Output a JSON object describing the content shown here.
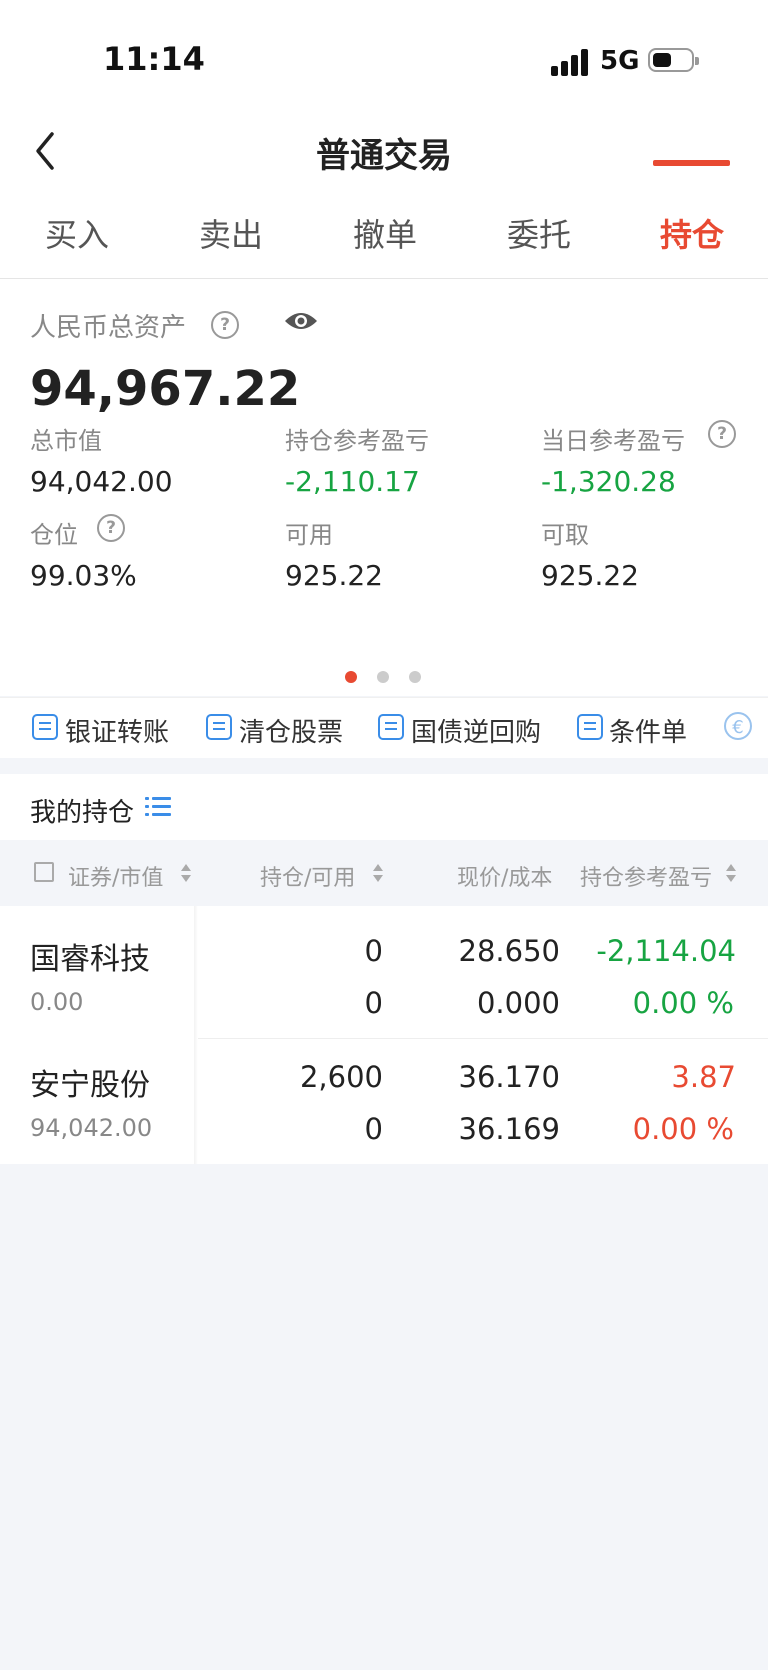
{
  "status_bar": {
    "time": "11:14",
    "network": "5G"
  },
  "nav": {
    "title": "普通交易"
  },
  "tabs": [
    {
      "label": "买入",
      "active": false
    },
    {
      "label": "卖出",
      "active": false
    },
    {
      "label": "撤单",
      "active": false
    },
    {
      "label": "委托",
      "active": false
    },
    {
      "label": "持仓",
      "active": true
    }
  ],
  "asset": {
    "label": "人民币总资产",
    "total": "94,967.22",
    "stats": [
      {
        "label": "总市值",
        "value": "94,042.00"
      },
      {
        "label": "持仓参考盈亏",
        "value": "-2,110.17"
      },
      {
        "label": "当日参考盈亏",
        "value": "-1,320.28"
      },
      {
        "label": "仓位",
        "value": "99.03%"
      },
      {
        "label": "可用",
        "value": "925.22"
      },
      {
        "label": "可取",
        "value": "925.22"
      }
    ],
    "page_indicator": {
      "count": 3,
      "active": 1
    }
  },
  "tools": [
    {
      "label": "银证转账",
      "icon": "transfer-icon"
    },
    {
      "label": "清仓股票",
      "icon": "chart-clear-icon"
    },
    {
      "label": "国债逆回购",
      "icon": "repo-icon"
    },
    {
      "label": "条件单",
      "icon": "condition-order-icon"
    }
  ],
  "holdings": {
    "title": "我的持仓",
    "columns": [
      "证券/市值",
      "持仓/可用",
      "现价/成本",
      "持仓参考盈亏"
    ],
    "rows": [
      {
        "name": "国睿科技",
        "market_value": "0.00",
        "position": "0",
        "available": "0",
        "price": "28.650",
        "cost": "0.000",
        "pnl": "-2,114.04",
        "pnl_pct": "0.00 %",
        "color": "green"
      },
      {
        "name": "安宁股份",
        "market_value": "94,042.00",
        "position": "2,600",
        "available": "0",
        "price": "36.170",
        "cost": "36.169",
        "pnl": "3.87",
        "pnl_pct": "0.00 %",
        "color": "red"
      }
    ]
  },
  "colors": {
    "accent": "#e84a32",
    "gain_up": "#e84a32",
    "gain_down": "#17a442",
    "link": "#3a8de8"
  }
}
